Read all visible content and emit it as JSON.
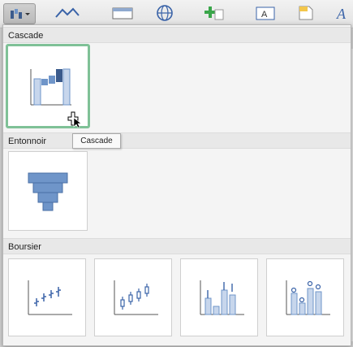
{
  "toolbar": {
    "selected_chart_icon": "waterfall-chart-icon",
    "buttons": [
      "line-chart-icon",
      "table-icon",
      "globe-icon",
      "add-icon",
      "text-box-icon",
      "note-icon"
    ]
  },
  "sections": {
    "cascade": {
      "title": "Cascade"
    },
    "funnel": {
      "title": "Entonnoir"
    },
    "stock": {
      "title": "Boursier"
    }
  },
  "tooltip": {
    "text": "Cascade"
  },
  "colors": {
    "accent_border": "#7fc197",
    "chart_fill": "#6f95c9",
    "chart_light": "#c7d6ec"
  }
}
